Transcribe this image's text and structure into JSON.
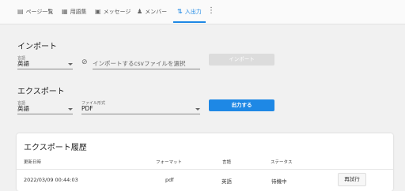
{
  "tabs": [
    {
      "icon": "book-icon",
      "glyph": "▤",
      "label": "ページ一覧"
    },
    {
      "icon": "document-icon",
      "glyph": "▦",
      "label": "用語集"
    },
    {
      "icon": "message-icon",
      "glyph": "▣",
      "label": "メッセージ"
    },
    {
      "icon": "members-icon",
      "glyph": "♟",
      "label": "メンバー"
    },
    {
      "icon": "import-export-icon",
      "glyph": "⇅",
      "label": "入出力"
    }
  ],
  "active_tab": "入出力",
  "accent_color": "#1e88e5",
  "import": {
    "title": "インポート",
    "language_label": "言語",
    "language_value": "英語",
    "file_placeholder": "インポートするcsvファイルを選択",
    "button_label": "インポート"
  },
  "export": {
    "title": "エクスポート",
    "language_label": "言語",
    "language_value": "英語",
    "format_label": "ファイル形式",
    "format_value": "PDF",
    "button_label": "出力する"
  },
  "history": {
    "title": "エクスポート履歴",
    "columns": [
      "更新日時",
      "フォーマット",
      "言語",
      "ステータス"
    ],
    "rows": [
      {
        "updated": "2022/03/09 00:44:03",
        "format": "pdf",
        "language": "英語",
        "status": "待機中",
        "action": "再試行"
      }
    ]
  }
}
